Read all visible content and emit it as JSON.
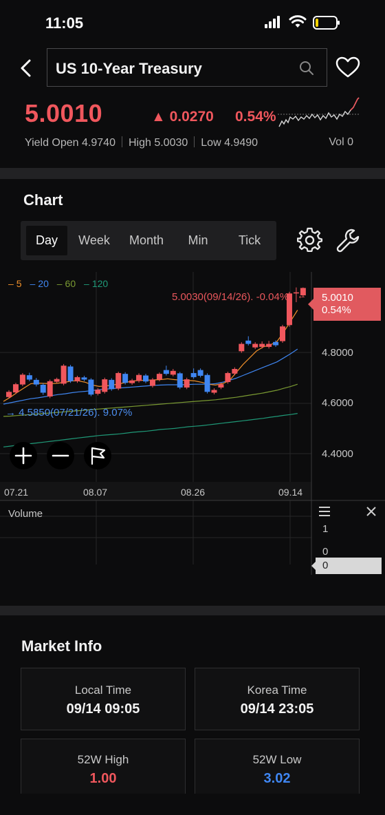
{
  "status_bar": {
    "time": "11:05"
  },
  "header": {
    "title": "US 10-Year Treasury"
  },
  "quote": {
    "price": "5.0010",
    "change": "▲ 0.0270",
    "change_pct": "0.54%",
    "yield_open_label": "Yield Open",
    "yield_open": "4.9740",
    "high_label": "High",
    "high": "5.0030",
    "low_label": "Low",
    "low": "4.9490",
    "vol_label": "Vol",
    "vol": "0"
  },
  "chart_section": {
    "title": "Chart",
    "tabs": [
      {
        "label": "Day",
        "active": true
      },
      {
        "label": "Week",
        "active": false
      },
      {
        "label": "Month",
        "active": false
      },
      {
        "label": "Min",
        "active": false
      },
      {
        "label": "Tick",
        "active": false
      }
    ]
  },
  "colors": {
    "up": "#f0575d",
    "down": "#3f86f2",
    "ma5": "#f0902a",
    "ma20": "#3f86f2",
    "ma60": "#7a9a32",
    "ma120": "#1f9a78"
  },
  "chart_data": {
    "type": "candlestick",
    "moving_average_legend": [
      {
        "name": "5",
        "color": "#f0902a"
      },
      {
        "name": "20",
        "color": "#3f86f2"
      },
      {
        "name": "60",
        "color": "#7a9a32"
      },
      {
        "name": "120",
        "color": "#1f9a78"
      }
    ],
    "ylim": [
      4.29,
      5.06
    ],
    "y_ticks": [
      "4.8000",
      "4.6000",
      "4.4000"
    ],
    "x_ticks": [
      "07.21",
      "08.07",
      "08.26",
      "09.14"
    ],
    "current_price_tag": {
      "price": "5.0010",
      "pct": "0.54%"
    },
    "high_annotation": "5.0030(09/14/26). -0.04%",
    "low_annotation": "4.5850(07/21/26). 9.07%",
    "candles": [
      {
        "o": 4.601,
        "c": 4.62,
        "h": 4.626,
        "l": 4.596
      },
      {
        "o": 4.618,
        "c": 4.648,
        "h": 4.653,
        "l": 4.612
      },
      {
        "o": 4.647,
        "c": 4.683,
        "h": 4.689,
        "l": 4.641
      },
      {
        "o": 4.681,
        "c": 4.665,
        "h": 4.69,
        "l": 4.659
      },
      {
        "o": 4.664,
        "c": 4.647,
        "h": 4.671,
        "l": 4.64
      },
      {
        "o": 4.646,
        "c": 4.617,
        "h": 4.652,
        "l": 4.609
      },
      {
        "o": 4.603,
        "c": 4.659,
        "h": 4.665,
        "l": 4.597
      },
      {
        "o": 4.657,
        "c": 4.667,
        "h": 4.672,
        "l": 4.652
      },
      {
        "o": 4.65,
        "c": 4.716,
        "h": 4.722,
        "l": 4.644
      },
      {
        "o": 4.713,
        "c": 4.659,
        "h": 4.719,
        "l": 4.653
      },
      {
        "o": 4.659,
        "c": 4.674,
        "h": 4.679,
        "l": 4.653
      },
      {
        "o": 4.673,
        "c": 4.665,
        "h": 4.679,
        "l": 4.659
      },
      {
        "o": 4.665,
        "c": 4.61,
        "h": 4.67,
        "l": 4.604
      },
      {
        "o": 4.613,
        "c": 4.628,
        "h": 4.634,
        "l": 4.607
      },
      {
        "o": 4.62,
        "c": 4.666,
        "h": 4.672,
        "l": 4.614
      },
      {
        "o": 4.664,
        "c": 4.63,
        "h": 4.67,
        "l": 4.624
      },
      {
        "o": 4.632,
        "c": 4.689,
        "h": 4.694,
        "l": 4.626
      },
      {
        "o": 4.686,
        "c": 4.653,
        "h": 4.692,
        "l": 4.647
      },
      {
        "o": 4.652,
        "c": 4.662,
        "h": 4.668,
        "l": 4.646
      },
      {
        "o": 4.66,
        "c": 4.682,
        "h": 4.688,
        "l": 4.654
      },
      {
        "o": 4.68,
        "c": 4.658,
        "h": 4.686,
        "l": 4.652
      },
      {
        "o": 4.642,
        "c": 4.665,
        "h": 4.671,
        "l": 4.636
      },
      {
        "o": 4.665,
        "c": 4.686,
        "h": 4.691,
        "l": 4.659
      },
      {
        "o": 4.7,
        "c": 4.686,
        "h": 4.716,
        "l": 4.68
      },
      {
        "o": 4.683,
        "c": 4.697,
        "h": 4.704,
        "l": 4.677
      },
      {
        "o": 4.688,
        "c": 4.636,
        "h": 4.693,
        "l": 4.63
      },
      {
        "o": 4.636,
        "c": 4.666,
        "h": 4.672,
        "l": 4.63
      },
      {
        "o": 4.689,
        "c": 4.674,
        "h": 4.706,
        "l": 4.668
      },
      {
        "o": 4.7,
        "c": 4.679,
        "h": 4.706,
        "l": 4.673
      },
      {
        "o": 4.682,
        "c": 4.62,
        "h": 4.688,
        "l": 4.614
      },
      {
        "o": 4.617,
        "c": 4.627,
        "h": 4.633,
        "l": 4.611
      },
      {
        "o": 4.636,
        "c": 4.648,
        "h": 4.654,
        "l": 4.63
      },
      {
        "o": 4.656,
        "c": 4.689,
        "h": 4.694,
        "l": 4.65
      },
      {
        "o": 4.687,
        "c": 4.704,
        "h": 4.71,
        "l": 4.681
      },
      {
        "o": 4.769,
        "c": 4.796,
        "h": 4.802,
        "l": 4.763
      },
      {
        "o": 4.808,
        "c": 4.796,
        "h": 4.824,
        "l": 4.79
      },
      {
        "o": 4.783,
        "c": 4.796,
        "h": 4.802,
        "l": 4.777
      },
      {
        "o": 4.785,
        "c": 4.796,
        "h": 4.805,
        "l": 4.779
      },
      {
        "o": 4.785,
        "c": 4.796,
        "h": 4.807,
        "l": 4.779
      },
      {
        "o": 4.803,
        "c": 4.791,
        "h": 4.809,
        "l": 4.785
      },
      {
        "o": 4.806,
        "c": 4.86,
        "h": 4.866,
        "l": 4.8
      },
      {
        "o": 4.865,
        "c": 4.981,
        "h": 4.987,
        "l": 4.859
      },
      {
        "o": 4.981,
        "c": 4.985,
        "h": 5.003,
        "l": 4.949
      },
      {
        "o": 4.974,
        "c": 5.001,
        "h": 5.003,
        "l": 4.968
      }
    ],
    "ma5": [
      4.585,
      4.6,
      4.618,
      4.634,
      4.65,
      4.652,
      4.651,
      4.65,
      4.652,
      4.655,
      4.66,
      4.66,
      4.655,
      4.645,
      4.64,
      4.642,
      4.645,
      4.65,
      4.655,
      4.66,
      4.662,
      4.663,
      4.664,
      4.665,
      4.668,
      4.665,
      4.663,
      4.662,
      4.66,
      4.655,
      4.648,
      4.645,
      4.65,
      4.66,
      4.69,
      4.72,
      4.745,
      4.77,
      4.785,
      4.792,
      4.805,
      4.84,
      4.88,
      4.92
    ],
    "ma20": [
      4.575,
      4.58,
      4.585,
      4.59,
      4.595,
      4.598,
      4.602,
      4.606,
      4.61,
      4.613,
      4.617,
      4.62,
      4.622,
      4.625,
      4.628,
      4.63,
      4.632,
      4.634,
      4.636,
      4.638,
      4.64,
      4.642,
      4.644,
      4.645,
      4.646,
      4.646,
      4.646,
      4.647,
      4.648,
      4.648,
      4.648,
      4.65,
      4.655,
      4.662,
      4.67,
      4.68,
      4.69,
      4.7,
      4.71,
      4.72,
      4.73,
      4.745,
      4.76,
      4.777
    ],
    "ma60": [
      4.53,
      4.531,
      4.533,
      4.535,
      4.537,
      4.539,
      4.541,
      4.543,
      4.545,
      4.547,
      4.549,
      4.551,
      4.553,
      4.555,
      4.557,
      4.559,
      4.561,
      4.563,
      4.565,
      4.567,
      4.569,
      4.571,
      4.573,
      4.575,
      4.577,
      4.579,
      4.581,
      4.583,
      4.585,
      4.587,
      4.589,
      4.591,
      4.594,
      4.597,
      4.6,
      4.604,
      4.608,
      4.612,
      4.616,
      4.621,
      4.626,
      4.633,
      4.64,
      4.648
    ],
    "ma120": [
      4.418,
      4.421,
      4.424,
      4.427,
      4.43,
      4.433,
      4.436,
      4.439,
      4.442,
      4.445,
      4.448,
      4.451,
      4.454,
      4.457,
      4.46,
      4.462,
      4.464,
      4.466,
      4.469,
      4.472,
      4.474,
      4.476,
      4.479,
      4.482,
      4.484,
      4.486,
      4.489,
      4.492,
      4.494,
      4.496,
      4.499,
      4.502,
      4.505,
      4.508,
      4.511,
      4.514,
      4.517,
      4.52,
      4.523,
      4.527,
      4.53,
      4.534,
      4.537,
      4.541
    ]
  },
  "volume_panel": {
    "title": "Volume",
    "ticks": [
      "1",
      "0"
    ],
    "current": "0"
  },
  "market_info": {
    "title": "Market Info",
    "cards": [
      {
        "label": "Local Time",
        "value": "09/14 09:05",
        "color": "#f2f2f2"
      },
      {
        "label": "Korea Time",
        "value": "09/14 23:05",
        "color": "#f2f2f2"
      },
      {
        "label": "52W High",
        "value": "1.00",
        "color": "#f0575d"
      },
      {
        "label": "52W Low",
        "value": "3.02",
        "color": "#3f86f2"
      }
    ]
  }
}
